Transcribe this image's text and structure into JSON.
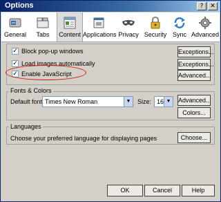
{
  "window": {
    "title": "Options"
  },
  "toolbar": {
    "panes": [
      {
        "label": "General",
        "icon": "general-switch-icon"
      },
      {
        "label": "Tabs",
        "icon": "tabs-icon"
      },
      {
        "label": "Content",
        "icon": "content-icon"
      },
      {
        "label": "Applications",
        "icon": "applications-icon"
      },
      {
        "label": "Privacy",
        "icon": "privacy-mask-icon"
      },
      {
        "label": "Security",
        "icon": "security-lock-icon"
      },
      {
        "label": "Sync",
        "icon": "sync-icon"
      },
      {
        "label": "Advanced",
        "icon": "advanced-gear-icon"
      }
    ],
    "selected": "Content"
  },
  "content": {
    "block_popups": {
      "label": "Block pop-up windows",
      "checked": true,
      "button": "Exceptions..."
    },
    "load_images": {
      "label": "Load images automatically",
      "checked": true,
      "button": "Exceptions..."
    },
    "enable_js": {
      "label": "Enable JavaScript",
      "checked": true,
      "button": "Advanced..."
    }
  },
  "fonts": {
    "group_title": "Fonts & Colors",
    "default_font_label": "Default font:",
    "default_font_value": "Times New Roman",
    "size_label": "Size:",
    "size_value": "16",
    "advanced_button": "Advanced...",
    "colors_button": "Colors..."
  },
  "languages": {
    "group_title": "Languages",
    "description": "Choose your preferred language for displaying pages",
    "choose_button": "Choose..."
  },
  "footer": {
    "ok": "OK",
    "cancel": "Cancel",
    "help": "Help"
  },
  "colors": {
    "highlight_circle": "#cc1111",
    "title_bar": "#0a246a"
  }
}
